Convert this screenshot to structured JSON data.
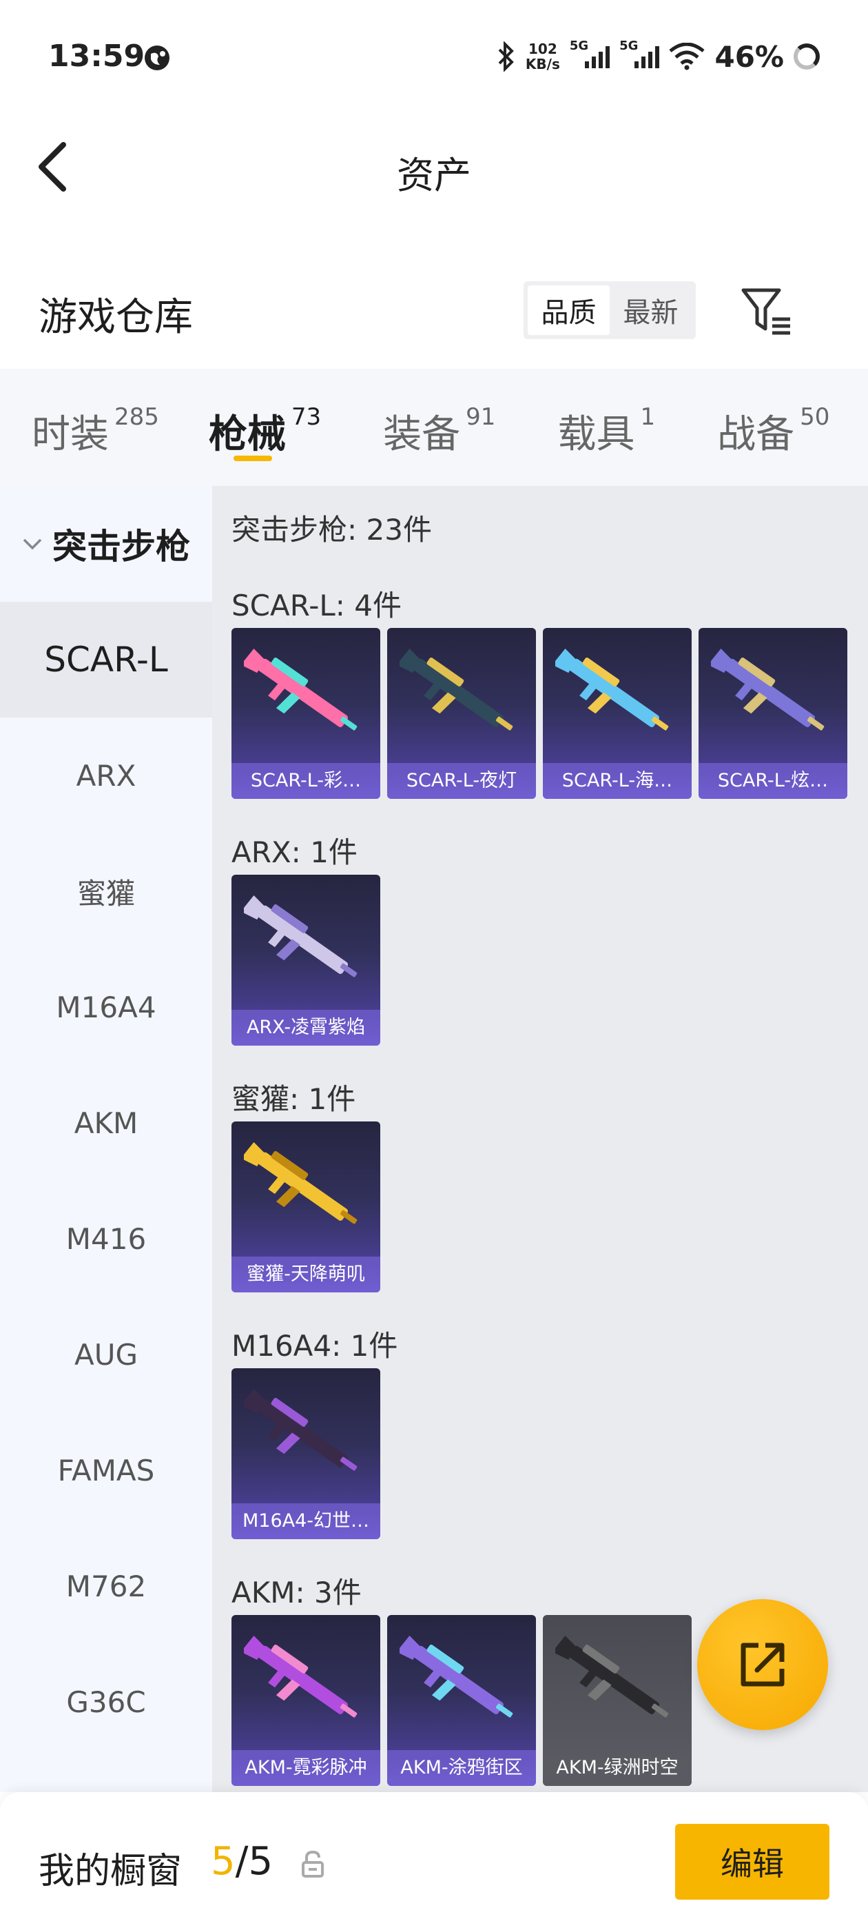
{
  "status_bar": {
    "time": "13:59",
    "speed_value": "102",
    "speed_unit": "KB/s",
    "net1": "5G",
    "net2": "5G",
    "battery": "46%"
  },
  "header": {
    "title": "资产"
  },
  "section": {
    "title": "游戏仓库",
    "sort_options": [
      "品质",
      "最新"
    ],
    "sort_selected": "品质"
  },
  "tabs": [
    {
      "label": "时装",
      "count": "285"
    },
    {
      "label": "枪械",
      "count": "73",
      "active": true
    },
    {
      "label": "装备",
      "count": "91"
    },
    {
      "label": "载具",
      "count": "1"
    },
    {
      "label": "战备",
      "count": "50"
    }
  ],
  "sidebar": {
    "category": "突击步枪",
    "items": [
      "SCAR-L",
      "ARX",
      "蜜獾",
      "M16A4",
      "AKM",
      "M416",
      "AUG",
      "FAMAS",
      "M762",
      "G36C"
    ],
    "selected": "SCAR-L"
  },
  "content": {
    "total": "突击步枪: 23件",
    "groups": [
      {
        "label": "SCAR-L: 4件",
        "items": [
          {
            "name": "SCAR-L-彩…",
            "gun_color": "#ff6fa8",
            "accent": "#55e0d6"
          },
          {
            "name": "SCAR-L-夜灯",
            "gun_color": "#2f4a5a",
            "accent": "#e0c050"
          },
          {
            "name": "SCAR-L-海…",
            "gun_color": "#63c6f2",
            "accent": "#f2c94c"
          },
          {
            "name": "SCAR-L-炫…",
            "gun_color": "#7b76d8",
            "accent": "#d9c27a"
          }
        ]
      },
      {
        "label": "ARX: 1件",
        "items": [
          {
            "name": "ARX-凌霄紫焰",
            "gun_color": "#cfc7e8",
            "accent": "#8a7bd1"
          }
        ]
      },
      {
        "label": "蜜獾: 1件",
        "items": [
          {
            "name": "蜜獾-天降萌叽",
            "gun_color": "#f2c233",
            "accent": "#c08a10"
          }
        ]
      },
      {
        "label": "M16A4: 1件",
        "items": [
          {
            "name": "M16A4-幻世…",
            "gun_color": "#3a2a4a",
            "accent": "#9a5ad8"
          }
        ]
      },
      {
        "label": "AKM: 3件",
        "items": [
          {
            "name": "AKM-霓彩脉冲",
            "gun_color": "#b14ee0",
            "accent": "#f28ad0"
          },
          {
            "name": "AKM-涂鸦街区",
            "gun_color": "#8a6ae0",
            "accent": "#6fd8f0"
          },
          {
            "name": "AKM-绿洲时空",
            "gun_color": "#2a2a2e",
            "accent": "#777",
            "grey": true
          }
        ]
      }
    ]
  },
  "bottom_bar": {
    "label": "我的橱窗",
    "count_current": "5",
    "count_total": "/5",
    "edit_label": "编辑"
  },
  "colors": {
    "accent": "#f7b500",
    "tab_underline": "#f6b800"
  },
  "icons": [
    "back-arrow-icon",
    "filter-icon",
    "chevron-down-icon",
    "share-icon",
    "lock-icon"
  ]
}
